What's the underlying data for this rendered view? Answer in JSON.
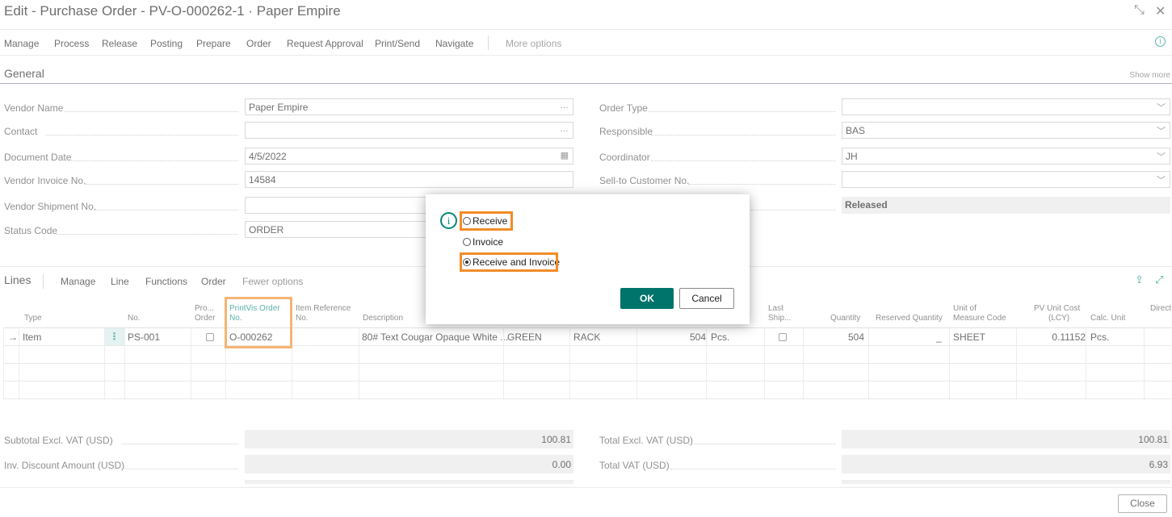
{
  "window": {
    "title": "Edit - Purchase Order - PV-O-000262-1 · Paper Empire",
    "collapse_icon": "⤡",
    "close_icon": "✕"
  },
  "action_bar": {
    "items": [
      "Manage",
      "Process",
      "Release",
      "Posting",
      "Prepare",
      "Order",
      "Request Approval",
      "Print/Send",
      "Navigate"
    ],
    "more_options": "More options"
  },
  "general": {
    "title": "General",
    "show_more": "Show more",
    "left_fields": [
      {
        "label": "Vendor Name",
        "value": "Paper Empire",
        "icon": "…"
      },
      {
        "label": "Contact",
        "value": "",
        "icon": "…"
      },
      {
        "label": "Document Date",
        "value": "4/5/2022",
        "icon": "📅"
      },
      {
        "label": "Vendor Invoice No.",
        "value": "14584",
        "icon": ""
      },
      {
        "label": "Vendor Shipment No.",
        "value": "",
        "icon": ""
      },
      {
        "label": "Status Code",
        "value": "ORDER",
        "icon": ""
      }
    ],
    "right_fields": [
      {
        "label": "Order Type",
        "value": "",
        "icon": "﹀"
      },
      {
        "label": "Responsible",
        "value": "BAS",
        "icon": "﹀"
      },
      {
        "label": "Coordinator",
        "value": "JH",
        "icon": "﹀"
      },
      {
        "label": "Sell-to Customer No.",
        "value": "",
        "icon": "﹀"
      },
      {
        "label": "",
        "value": "Released",
        "icon": ""
      }
    ]
  },
  "lines": {
    "title": "Lines",
    "menu": [
      "Manage",
      "Line",
      "Functions",
      "Order"
    ],
    "fewer_options": "Fewer options",
    "share_icon": "⇪",
    "expand_icon": "⤢",
    "columns": {
      "type": "Type",
      "no": "No.",
      "pro_order": [
        "Pro...",
        "Order"
      ],
      "printvis": [
        "PrintVis Order",
        "No."
      ],
      "item_ref": [
        "Item Reference",
        "No."
      ],
      "description": "Description",
      "last_ship": [
        "Last",
        "Ship..."
      ],
      "quantity": "Quantity",
      "reserved": "Reserved Quantity",
      "uom": [
        "Unit of",
        "Measure Code"
      ],
      "pv_cost": [
        "PV Unit Cost",
        "(LCY)"
      ],
      "calc_unit": "Calc. Unit",
      "direct": "Direct"
    },
    "row": {
      "arrow": "→",
      "type": "Item",
      "kebab": "⋮",
      "no": "PS-001",
      "printvis": "O-000262",
      "description": "80# Text Cougar Opaque White ...",
      "color": "GREEN",
      "location": "RACK",
      "amount": "504",
      "unit": "Pcs.",
      "quantity": "504",
      "reserved": "_",
      "uom": "SHEET",
      "pv_cost": "0.11152",
      "calc_unit": "Pcs."
    }
  },
  "totals": {
    "subtotal_label": "Subtotal Excl. VAT (USD)",
    "subtotal_value": "100.81",
    "discount_label": "Inv. Discount Amount (USD)",
    "discount_value": "0.00",
    "total_excl_label": "Total Excl. VAT (USD)",
    "total_excl_value": "100.81",
    "total_vat_label": "Total VAT (USD)",
    "total_vat_value": "6.93"
  },
  "close_button": "Close",
  "dialog": {
    "info_icon": "i",
    "options": [
      "Receive",
      "Invoice",
      "Receive and Invoice"
    ],
    "selected": "Receive and Invoice",
    "ok": "OK",
    "cancel": "Cancel"
  },
  "colors": {
    "accent": "#00736b",
    "highlight": "#f28c28"
  }
}
